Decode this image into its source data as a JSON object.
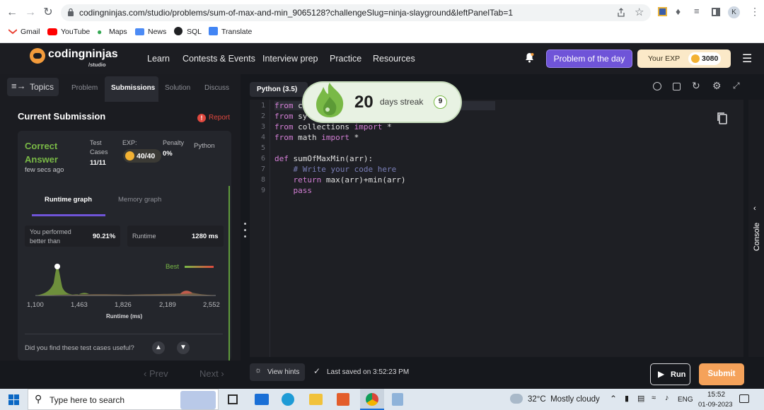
{
  "browser": {
    "url": "codingninjas.com/studio/problems/sum-of-max-and-min_9065128?challengeSlug=ninja-slayground&leftPanelTab=1",
    "profile_initial": "K",
    "bookmarks": [
      "Gmail",
      "YouTube",
      "Maps",
      "News",
      "SQL",
      "Translate"
    ]
  },
  "header": {
    "brand": "codingninjas",
    "brand_sub": "/studio",
    "nav": [
      "Learn",
      "Contests & Events",
      "Interview prep",
      "Practice",
      "Resources"
    ],
    "potd_label": "Problem of the day",
    "exp_label": "Your EXP",
    "exp_value": "3080"
  },
  "left_panel": {
    "topics_label": "Topics",
    "tabs": [
      "Problem",
      "Submissions",
      "Solution",
      "Discuss"
    ],
    "active_tab": "Submissions",
    "current_submission": "Current Submission",
    "report": "Report",
    "status_line1": "Correct",
    "status_line2": "Answer",
    "time_ago": "few secs ago",
    "test_cases_label_1": "Test",
    "test_cases_label_2": "Cases",
    "test_cases_value": "11/11",
    "exp_label": "EXP:",
    "exp_value": "40/40",
    "penalty_label": "Penalty",
    "penalty_value": "0%",
    "language": "Python",
    "graph_tabs": [
      "Runtime graph",
      "Memory graph"
    ],
    "performed_label_1": "You performed",
    "performed_label_2": "better than",
    "performed_value": "90.21%",
    "runtime_label": "Runtime",
    "runtime_value": "1280 ms",
    "best_label": "Best",
    "x_ticks": [
      "1,100",
      "1,463",
      "1,826",
      "2,189",
      "2,552"
    ],
    "x_axis_label": "Runtime (ms)",
    "feedback_q": "Did you find these test cases useful?"
  },
  "editor": {
    "language": "Python (3.5)",
    "streak_value": "20",
    "streak_label": "days streak",
    "streak_badge": "9",
    "lines": [
      {
        "n": "1",
        "text": "from c"
      },
      {
        "n": "2",
        "text": "from sy"
      },
      {
        "n": "3",
        "text": "from collections import *"
      },
      {
        "n": "4",
        "text": "from math import *"
      },
      {
        "n": "5",
        "text": ""
      },
      {
        "n": "6",
        "text": "def sumOfMaxMin(arr):"
      },
      {
        "n": "7",
        "text": "    # Write your code here"
      },
      {
        "n": "8",
        "text": "    return max(arr)+min(arr)"
      },
      {
        "n": "9",
        "text": "    pass"
      }
    ],
    "console_label": "Console"
  },
  "footer": {
    "prev": "Prev",
    "next": "Next",
    "view_hints": "View hints",
    "last_saved": "Last saved on 3:52:23 PM",
    "run": "Run",
    "submit": "Submit"
  },
  "taskbar": {
    "search_placeholder": "Type here to search",
    "weather": "32°C  Mostly cloudy",
    "lang": "ENG",
    "time": "15:52",
    "date": "01-09-2023"
  },
  "colors": {
    "accent_orange": "#f5a25a",
    "potd_purple": "#6f54d8",
    "correct_green": "#79b946",
    "streak_bg": "#e8f2e3"
  }
}
